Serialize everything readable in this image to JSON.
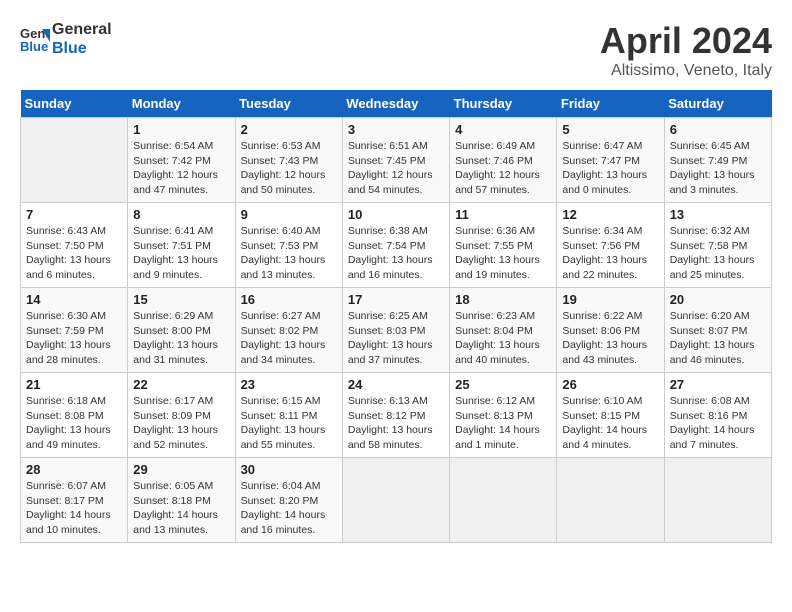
{
  "header": {
    "logo_line1": "General",
    "logo_line2": "Blue",
    "month": "April 2024",
    "location": "Altissimo, Veneto, Italy"
  },
  "weekdays": [
    "Sunday",
    "Monday",
    "Tuesday",
    "Wednesday",
    "Thursday",
    "Friday",
    "Saturday"
  ],
  "weeks": [
    [
      {
        "day": "",
        "info": ""
      },
      {
        "day": "1",
        "info": "Sunrise: 6:54 AM\nSunset: 7:42 PM\nDaylight: 12 hours\nand 47 minutes."
      },
      {
        "day": "2",
        "info": "Sunrise: 6:53 AM\nSunset: 7:43 PM\nDaylight: 12 hours\nand 50 minutes."
      },
      {
        "day": "3",
        "info": "Sunrise: 6:51 AM\nSunset: 7:45 PM\nDaylight: 12 hours\nand 54 minutes."
      },
      {
        "day": "4",
        "info": "Sunrise: 6:49 AM\nSunset: 7:46 PM\nDaylight: 12 hours\nand 57 minutes."
      },
      {
        "day": "5",
        "info": "Sunrise: 6:47 AM\nSunset: 7:47 PM\nDaylight: 13 hours\nand 0 minutes."
      },
      {
        "day": "6",
        "info": "Sunrise: 6:45 AM\nSunset: 7:49 PM\nDaylight: 13 hours\nand 3 minutes."
      }
    ],
    [
      {
        "day": "7",
        "info": "Sunrise: 6:43 AM\nSunset: 7:50 PM\nDaylight: 13 hours\nand 6 minutes."
      },
      {
        "day": "8",
        "info": "Sunrise: 6:41 AM\nSunset: 7:51 PM\nDaylight: 13 hours\nand 9 minutes."
      },
      {
        "day": "9",
        "info": "Sunrise: 6:40 AM\nSunset: 7:53 PM\nDaylight: 13 hours\nand 13 minutes."
      },
      {
        "day": "10",
        "info": "Sunrise: 6:38 AM\nSunset: 7:54 PM\nDaylight: 13 hours\nand 16 minutes."
      },
      {
        "day": "11",
        "info": "Sunrise: 6:36 AM\nSunset: 7:55 PM\nDaylight: 13 hours\nand 19 minutes."
      },
      {
        "day": "12",
        "info": "Sunrise: 6:34 AM\nSunset: 7:56 PM\nDaylight: 13 hours\nand 22 minutes."
      },
      {
        "day": "13",
        "info": "Sunrise: 6:32 AM\nSunset: 7:58 PM\nDaylight: 13 hours\nand 25 minutes."
      }
    ],
    [
      {
        "day": "14",
        "info": "Sunrise: 6:30 AM\nSunset: 7:59 PM\nDaylight: 13 hours\nand 28 minutes."
      },
      {
        "day": "15",
        "info": "Sunrise: 6:29 AM\nSunset: 8:00 PM\nDaylight: 13 hours\nand 31 minutes."
      },
      {
        "day": "16",
        "info": "Sunrise: 6:27 AM\nSunset: 8:02 PM\nDaylight: 13 hours\nand 34 minutes."
      },
      {
        "day": "17",
        "info": "Sunrise: 6:25 AM\nSunset: 8:03 PM\nDaylight: 13 hours\nand 37 minutes."
      },
      {
        "day": "18",
        "info": "Sunrise: 6:23 AM\nSunset: 8:04 PM\nDaylight: 13 hours\nand 40 minutes."
      },
      {
        "day": "19",
        "info": "Sunrise: 6:22 AM\nSunset: 8:06 PM\nDaylight: 13 hours\nand 43 minutes."
      },
      {
        "day": "20",
        "info": "Sunrise: 6:20 AM\nSunset: 8:07 PM\nDaylight: 13 hours\nand 46 minutes."
      }
    ],
    [
      {
        "day": "21",
        "info": "Sunrise: 6:18 AM\nSunset: 8:08 PM\nDaylight: 13 hours\nand 49 minutes."
      },
      {
        "day": "22",
        "info": "Sunrise: 6:17 AM\nSunset: 8:09 PM\nDaylight: 13 hours\nand 52 minutes."
      },
      {
        "day": "23",
        "info": "Sunrise: 6:15 AM\nSunset: 8:11 PM\nDaylight: 13 hours\nand 55 minutes."
      },
      {
        "day": "24",
        "info": "Sunrise: 6:13 AM\nSunset: 8:12 PM\nDaylight: 13 hours\nand 58 minutes."
      },
      {
        "day": "25",
        "info": "Sunrise: 6:12 AM\nSunset: 8:13 PM\nDaylight: 14 hours\nand 1 minute."
      },
      {
        "day": "26",
        "info": "Sunrise: 6:10 AM\nSunset: 8:15 PM\nDaylight: 14 hours\nand 4 minutes."
      },
      {
        "day": "27",
        "info": "Sunrise: 6:08 AM\nSunset: 8:16 PM\nDaylight: 14 hours\nand 7 minutes."
      }
    ],
    [
      {
        "day": "28",
        "info": "Sunrise: 6:07 AM\nSunset: 8:17 PM\nDaylight: 14 hours\nand 10 minutes."
      },
      {
        "day": "29",
        "info": "Sunrise: 6:05 AM\nSunset: 8:18 PM\nDaylight: 14 hours\nand 13 minutes."
      },
      {
        "day": "30",
        "info": "Sunrise: 6:04 AM\nSunset: 8:20 PM\nDaylight: 14 hours\nand 16 minutes."
      },
      {
        "day": "",
        "info": ""
      },
      {
        "day": "",
        "info": ""
      },
      {
        "day": "",
        "info": ""
      },
      {
        "day": "",
        "info": ""
      }
    ]
  ]
}
